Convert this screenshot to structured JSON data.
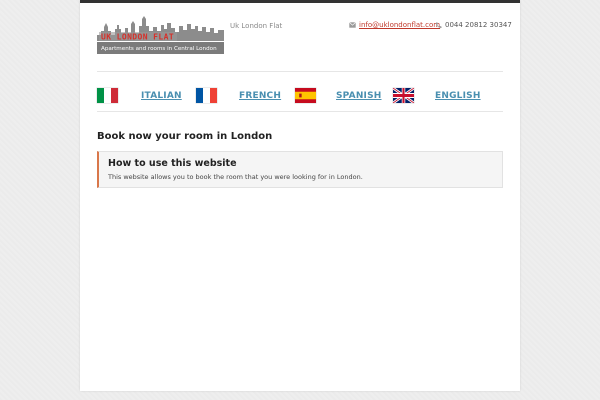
{
  "header": {
    "logo_title": "UK LONDON FLAT",
    "logo_subtitle": "Apartments and rooms in Central London",
    "site_name": "Uk London Flat",
    "email": "info@uklondonflat.com",
    "phone": "0044 20812 30347",
    "email_icon": "envelope-icon",
    "phone_icon": "phone-icon"
  },
  "languages": [
    {
      "label": "ITALIAN",
      "flag": "italy-flag-icon"
    },
    {
      "label": "FRENCH",
      "flag": "france-flag-icon"
    },
    {
      "label": "SPANISH",
      "flag": "spain-flag-icon"
    },
    {
      "label": "ENGLISH",
      "flag": "uk-flag-icon"
    }
  ],
  "main": {
    "heading": "Book now your room in London",
    "info_box": {
      "title": "How to use this website",
      "text": "This website allows you to book the room that you were looking for in London."
    }
  },
  "colors": {
    "link": "#4a8fb0",
    "email": "#c0392b",
    "accent_border": "#d9774a",
    "top_bar": "#333333"
  }
}
